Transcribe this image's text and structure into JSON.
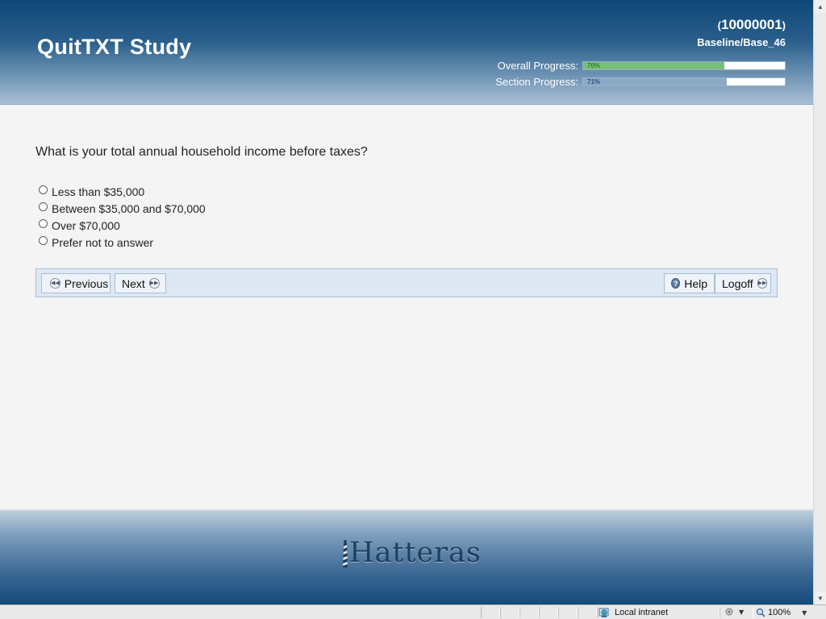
{
  "header": {
    "app_title": "QuitTXT Study",
    "participant_id": "10000001",
    "paren_open": "(",
    "paren_close": ")",
    "section_id": "Baseline/Base_46",
    "overall_label": "Overall Progress:",
    "overall_pct_text": "70%",
    "overall_fraction": 0.7,
    "section_label": "Section Progress:",
    "section_pct_text": "71%",
    "section_fraction": 0.71
  },
  "question": {
    "text": "What is your total annual household income before taxes?",
    "options": [
      "Less than $35,000",
      "Between $35,000 and $70,000",
      "Over $70,000",
      "Prefer not to answer"
    ]
  },
  "nav": {
    "previous": "Previous",
    "next": "Next",
    "help": "Help",
    "logoff": "Logoff"
  },
  "footer": {
    "brand": "Hatteras"
  },
  "statusbar": {
    "zone": "Local intranet",
    "zoom": "100%"
  },
  "colors": {
    "header_dark": "#0f4677",
    "progress_green": "#78c078",
    "progress_blue": "#8caac6",
    "nav_bg": "#dde8f4"
  }
}
